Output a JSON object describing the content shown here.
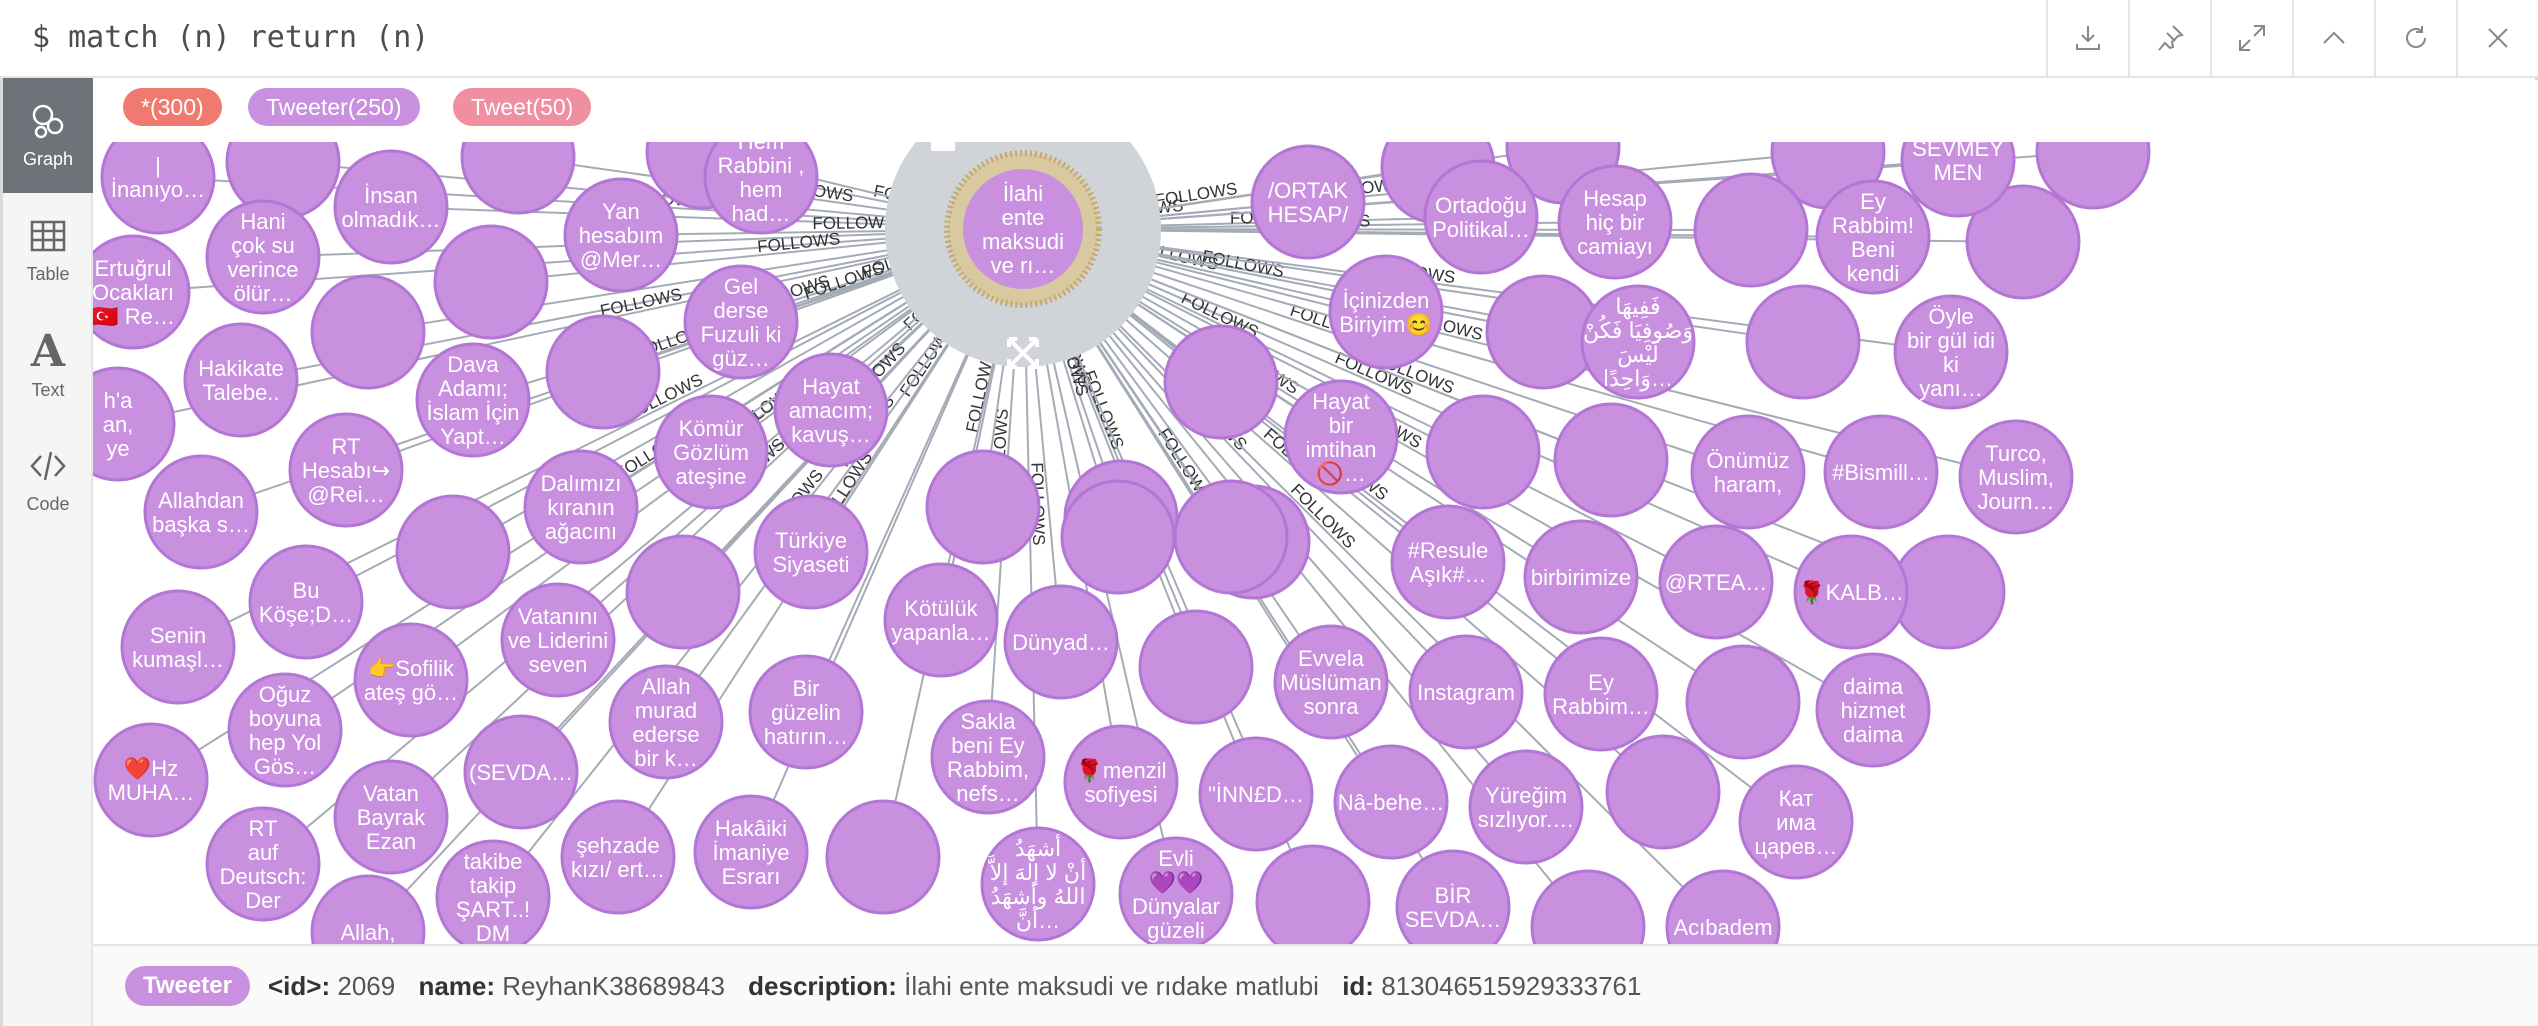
{
  "query": {
    "command": "$ match (n) return (n)"
  },
  "toolbar": {
    "buttons": [
      "download",
      "pin",
      "expand",
      "collapse",
      "rerun",
      "close"
    ]
  },
  "sidebar": {
    "items": [
      {
        "label": "Graph",
        "active": true
      },
      {
        "label": "Table",
        "active": false
      },
      {
        "label": "Text",
        "active": false
      },
      {
        "label": "Code",
        "active": false
      }
    ]
  },
  "legend": {
    "all": {
      "label": "*(300)",
      "color": "#f07a6f"
    },
    "tweeter": {
      "label": "Tweeter(250)",
      "color": "#c990e0"
    },
    "tweet": {
      "label": "Tweet(50)",
      "color": "#f08fa0"
    }
  },
  "graph": {
    "node_color": "#c990e0",
    "node_border": "#b376d4",
    "relationship_label": "FOLLOWS",
    "selected": {
      "label": [
        "İlahi",
        "ente",
        "maksudi",
        "ve rı…"
      ]
    },
    "nodes": [
      [
        "|",
        "İnanıyo…"
      ],
      [
        "İnsan",
        "olmadık…"
      ],
      [
        "Hem",
        "Rabbini ,",
        "hem",
        "had…"
      ],
      [
        "Hani",
        "çok su",
        "verince",
        "ölür…"
      ],
      [
        "Yan",
        "hesabım",
        "@Mer…"
      ],
      [
        "Ertuğrul",
        "Ocakları",
        "🇹🇷 Re…"
      ],
      [
        "Gel",
        "derse",
        "Fuzuli ki",
        "güz…"
      ],
      [
        "Hakikate",
        "Talebe.."
      ],
      [
        "Dava",
        "Adamı;",
        "İslam İçin",
        "Yapt…"
      ],
      [
        "RT",
        "Hesabı↪",
        "@Rei…"
      ],
      [
        "Hayat",
        "amacım;",
        "kavuş…"
      ],
      [
        "Kömür",
        "Gözlüm",
        "ateşine"
      ],
      [
        "Allahdan",
        "başka s…"
      ],
      [
        "Dalımızı",
        "kıranın",
        "ağacını"
      ],
      [
        "Türkiye",
        "Siyaseti"
      ],
      [
        "Bu",
        "Köşe;D…"
      ],
      [
        "Senin",
        "kumaşl…"
      ],
      [
        "Vatanını",
        "ve Liderini",
        "seven"
      ],
      [
        "Kötülük",
        "yapanla…"
      ],
      [
        "Dünyad…"
      ],
      [
        "👉Sofilik",
        "ateş gö…"
      ],
      [
        "Oğuz",
        "boyuna",
        "hep Yol",
        "Gös…"
      ],
      [
        "Allah",
        "murad",
        "ederse",
        "bir k…"
      ],
      [
        "Bir",
        "güzelin",
        "hatırın…"
      ],
      [
        "Sakla",
        "beni Ey",
        "Rabbim,",
        "nefs…"
      ],
      [
        "🌹menzil",
        "sofiyesi"
      ],
      [
        "❤️Hz",
        "MUHA…"
      ],
      [
        "(SEVDA…"
      ],
      [
        "Vatan",
        "Bayrak",
        "Ezan"
      ],
      [
        "RT",
        "auf",
        "Deutsch:",
        "Der"
      ],
      [
        "şehzade",
        "kızı/ ert…"
      ],
      [
        "Hakâiki",
        "İmaniye",
        "Esrarı"
      ],
      [
        "takibe",
        "takip",
        "ŞART..!",
        "DM"
      ],
      [
        "Allah,"
      ],
      [
        "أشهَدُ",
        "أنْ لا إلهَ إلاَّ",
        "اللهُ وأشهَدُ",
        "أنَّ…"
      ],
      [
        "Evli",
        "💜💜",
        "Dünyalar",
        "güzeli"
      ],
      [
        "/ORTAK",
        "HESAP/"
      ],
      [
        "Ortadoğu",
        "Politikal…"
      ],
      [
        "Hesap",
        "hiç bir",
        "camiayı"
      ],
      [
        "Ey",
        "Rabbim!",
        "Beni",
        "kendi"
      ],
      [
        "İçinizden",
        "Biriyim😊"
      ],
      [
        "فَفِيهَا",
        "وَصُوفِيَا فَكُنْ",
        "لَيْسَ",
        "وَاحِدًا…"
      ],
      [
        "Öyle",
        "bir gül idi",
        "ki",
        "yanı…"
      ],
      [
        "Hayat",
        "bir",
        "imtihan",
        "🚫…"
      ],
      [
        "Önümüz",
        "haram,"
      ],
      [
        "#Bismill…"
      ],
      [
        "Turco,",
        "Muslim,",
        "Journ…"
      ],
      [
        "#Resule",
        "Aşık#…"
      ],
      [
        "birbirimize"
      ],
      [
        "@RTEA…"
      ],
      [
        "🌹KALB…"
      ],
      [
        "Evvela",
        "Müslüman",
        "sonra"
      ],
      [
        "Instagram"
      ],
      [
        "Ey",
        "Rabbim…"
      ],
      [
        "daima",
        "hizmet",
        "daima"
      ],
      [
        "\"İNN£D…"
      ],
      [
        "Nâ-behe…"
      ],
      [
        "Yüreğim",
        "sızlıyor.…"
      ],
      [
        "Кат",
        "има",
        "царев…"
      ],
      [
        "BİR",
        "SEVDA…"
      ],
      [
        "Acıbadem"
      ],
      [
        "SEVMEY",
        "MEN"
      ],
      [
        "h'a",
        "an,",
        "ye"
      ]
    ]
  },
  "status": {
    "type": "Tweeter",
    "props": [
      {
        "key": "<id>:",
        "value": "2069"
      },
      {
        "key": "name:",
        "value": "ReyhanK38689843"
      },
      {
        "key": "description:",
        "value": "İlahi ente maksudi ve rıdake matlubi"
      },
      {
        "key": "id:",
        "value": "813046515929333761"
      }
    ]
  }
}
